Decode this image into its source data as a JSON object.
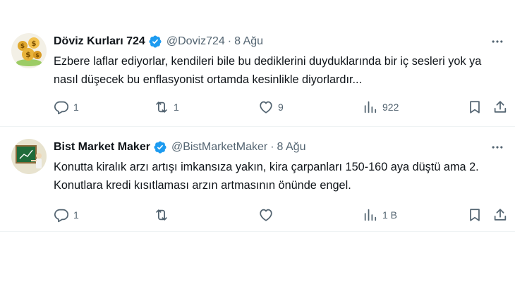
{
  "tweets": [
    {
      "name": "Döviz Kurları 724",
      "handle": "@Doviz724",
      "separator": "·",
      "time": "8 Ağu",
      "text": "Ezbere laflar ediyorlar, kendileri bile bu dediklerini duyduklarında bir iç sesleri yok ya nasıl düşecek bu enflasyonist ortamda kesinlikle diyorlardır...",
      "replies": "1",
      "retweets": "1",
      "likes": "9",
      "views": "922"
    },
    {
      "name": "Bist Market Maker",
      "handle": "@BistMarketMaker",
      "separator": "·",
      "time": "8 Ağu",
      "text": "Konutta kiralık arzı artışı imkansıza yakın, kira çarpanları 150-160 aya düştü ama 2. Konutlara kredi kısıtlaması arzın artmasının önünde engel.",
      "replies": "1",
      "retweets": "",
      "likes": "",
      "views": "1 B"
    }
  ],
  "colors": {
    "verified": "#1d9bf0",
    "muted": "#536471",
    "text": "#0f1419",
    "divider": "#eff3f4"
  },
  "icons": [
    "verified-badge-icon",
    "more-icon",
    "reply-icon",
    "retweet-icon",
    "like-icon",
    "views-icon",
    "bookmark-icon",
    "share-icon"
  ]
}
